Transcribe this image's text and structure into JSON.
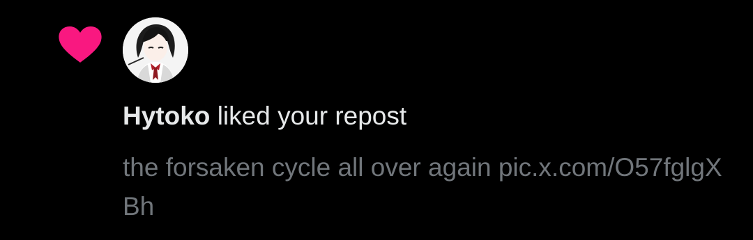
{
  "notification": {
    "type_icon": "heart-icon",
    "accent_color": "#f91880",
    "user_name": "Hytoko",
    "action_text": "liked your repost",
    "post_text": "the forsaken cycle all over again pic.x.com/O57fglgXBh",
    "avatar_icon": "avatar"
  }
}
